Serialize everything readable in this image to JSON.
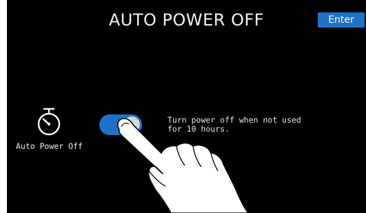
{
  "header": {
    "title": "AUTO POWER OFF",
    "enter_label": "Enter"
  },
  "setting": {
    "icon": "stopwatch-icon",
    "label": "Auto Power Off",
    "toggle_state": "on",
    "description_line1": "Turn power off when not used",
    "description_line2": "for 10 hours."
  },
  "colors": {
    "background": "#000000",
    "accent": "#1e73c8",
    "knob": "#d8d8da",
    "text": "#f2f2f2"
  }
}
